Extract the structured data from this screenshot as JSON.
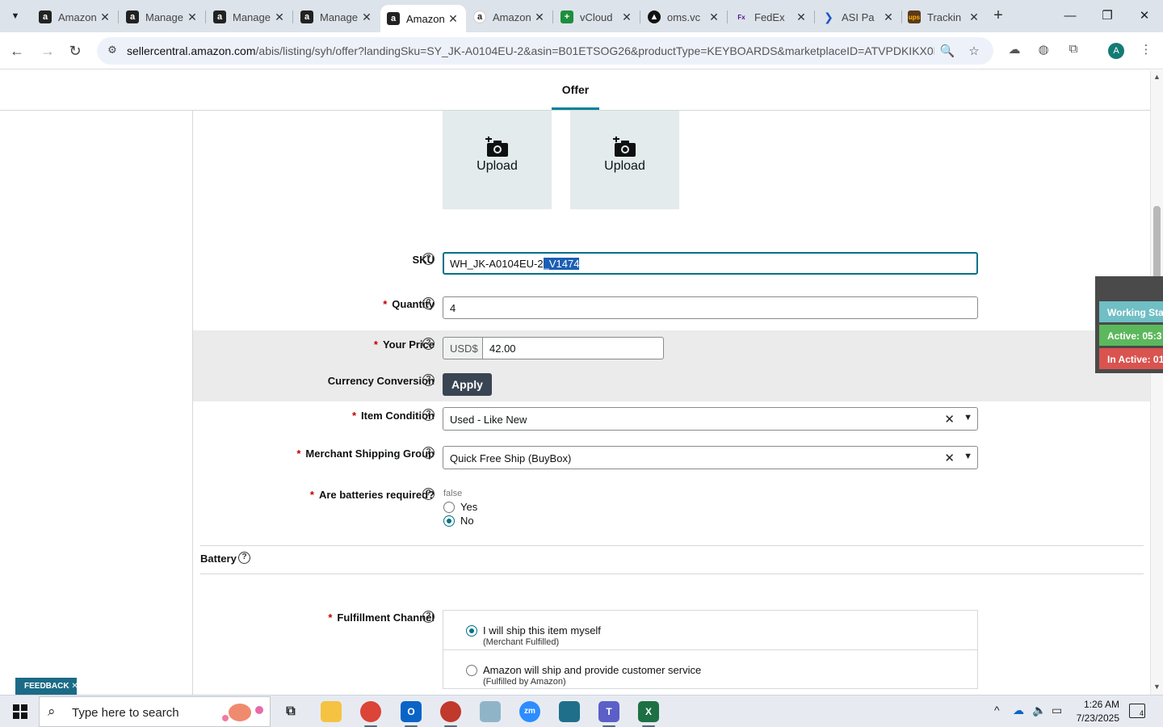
{
  "browser": {
    "tabs": [
      {
        "label": "Amazon",
        "favicon": "amazon-icon"
      },
      {
        "label": "Manage",
        "favicon": "amazon-icon"
      },
      {
        "label": "Manage",
        "favicon": "amazon-icon"
      },
      {
        "label": "Manage",
        "favicon": "amazon-icon"
      },
      {
        "label": "Amazon",
        "favicon": "amazon-icon",
        "active": true
      },
      {
        "label": "Amazon",
        "favicon": "amazon-smile-icon"
      },
      {
        "label": "vCloud",
        "favicon": "vcloud-icon"
      },
      {
        "label": "oms.vc",
        "favicon": "oms-icon"
      },
      {
        "label": "FedEx",
        "favicon": "fedex-icon"
      },
      {
        "label": "ASI Pa",
        "favicon": "asi-icon"
      },
      {
        "label": "Trackin",
        "favicon": "ups-icon"
      }
    ],
    "url_host": "sellercentral.amazon.com",
    "url_path": "/abis/listing/syh/offer?landingSku=SY_JK-A0104EU-2&asin=B01ETSOG26&productType=KEYBOARDS&marketplaceID=ATVPDKIKX0D...",
    "profile_initial": "A"
  },
  "page": {
    "section_tab": "Offer",
    "upload_label": "Upload",
    "sku": {
      "label": "SKU",
      "value_plain": "WH_JK-A0104EU-2",
      "value_selected": "_V1474"
    },
    "quantity": {
      "label": "Quantity",
      "value": "4"
    },
    "price": {
      "label": "Your Price",
      "currency": "USD$",
      "value": "42.00"
    },
    "currency_conversion": {
      "label": "Currency Conversion",
      "button": "Apply"
    },
    "item_condition": {
      "label": "Item Condition",
      "value": "Used - Like New"
    },
    "shipping_group": {
      "label": "Merchant Shipping Group",
      "value": "Quick Free Ship (BuyBox)"
    },
    "batteries": {
      "label": "Are batteries required?",
      "current": "false",
      "options": [
        {
          "label": "Yes",
          "checked": false
        },
        {
          "label": "No",
          "checked": true
        }
      ]
    },
    "battery_heading": "Battery",
    "fulfillment": {
      "label": "Fulfillment Channel",
      "options": [
        {
          "label": "I will ship this item myself",
          "sub": "(Merchant Fulfilled)",
          "checked": true
        },
        {
          "label": "Amazon will ship and provide customer service",
          "sub": "(Fulfilled by Amazon)",
          "checked": false
        }
      ]
    },
    "feedback": "FEEDBACK"
  },
  "tracker": {
    "working": "Working Sta",
    "active": "Active: 05:3",
    "inactive": "In Active: 01",
    "colors": {
      "working": "#6fbfc5",
      "active": "#5cb85c",
      "inactive": "#d9534f"
    }
  },
  "taskbar": {
    "search_placeholder": "Type here to search",
    "time": "1:26 AM",
    "date": "7/23/2025",
    "notifications": "4"
  },
  "colors": {
    "accent": "#007185",
    "tab_underline": "#00829a",
    "apply_button": "#3a4553",
    "required": "#c40000"
  }
}
